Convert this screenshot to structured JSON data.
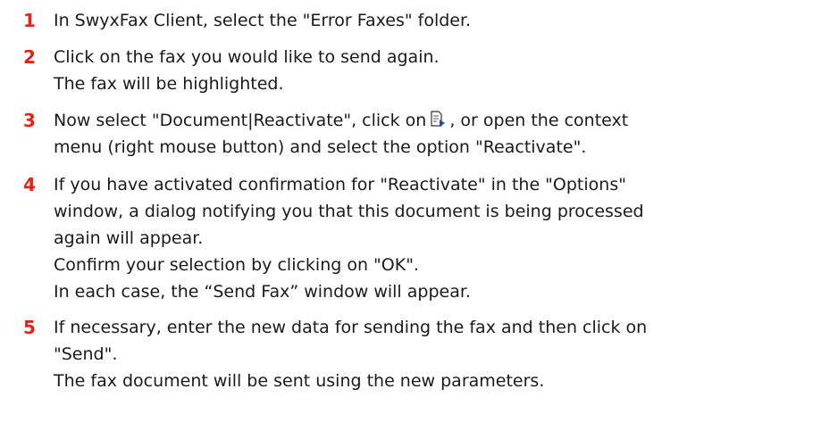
{
  "steps": [
    {
      "number": "1",
      "lines": [
        "In SwyxFax Client, select the \"Error Faxes\" folder."
      ]
    },
    {
      "number": "2",
      "lines": [
        "Click on the fax you would like to send again.",
        "The fax will be highlighted."
      ]
    },
    {
      "number": "3",
      "line1_before": "Now select \"Document|Reactivate\", click on",
      "line1_after": ", or open the context",
      "line2": "menu (right mouse button) and select the option \"Reactivate\".",
      "icon": "reactivate-document-icon"
    },
    {
      "number": "4",
      "lines": [
        "If you have activated confirmation for \"Reactivate\" in the \"Options\"",
        "window, a dialog notifying you that this document is being processed",
        "again will appear.",
        "Confirm your selection by clicking on \"OK\".",
        "In each case, the “Send Fax” window will appear."
      ]
    },
    {
      "number": "5",
      "lines": [
        "If necessary, enter the new data for sending the fax and then click on",
        "\"Send\".",
        "The fax document will be sent using the new parameters."
      ]
    }
  ],
  "colors": {
    "step_number": "#e2231a",
    "text": "#1a1a1a"
  }
}
